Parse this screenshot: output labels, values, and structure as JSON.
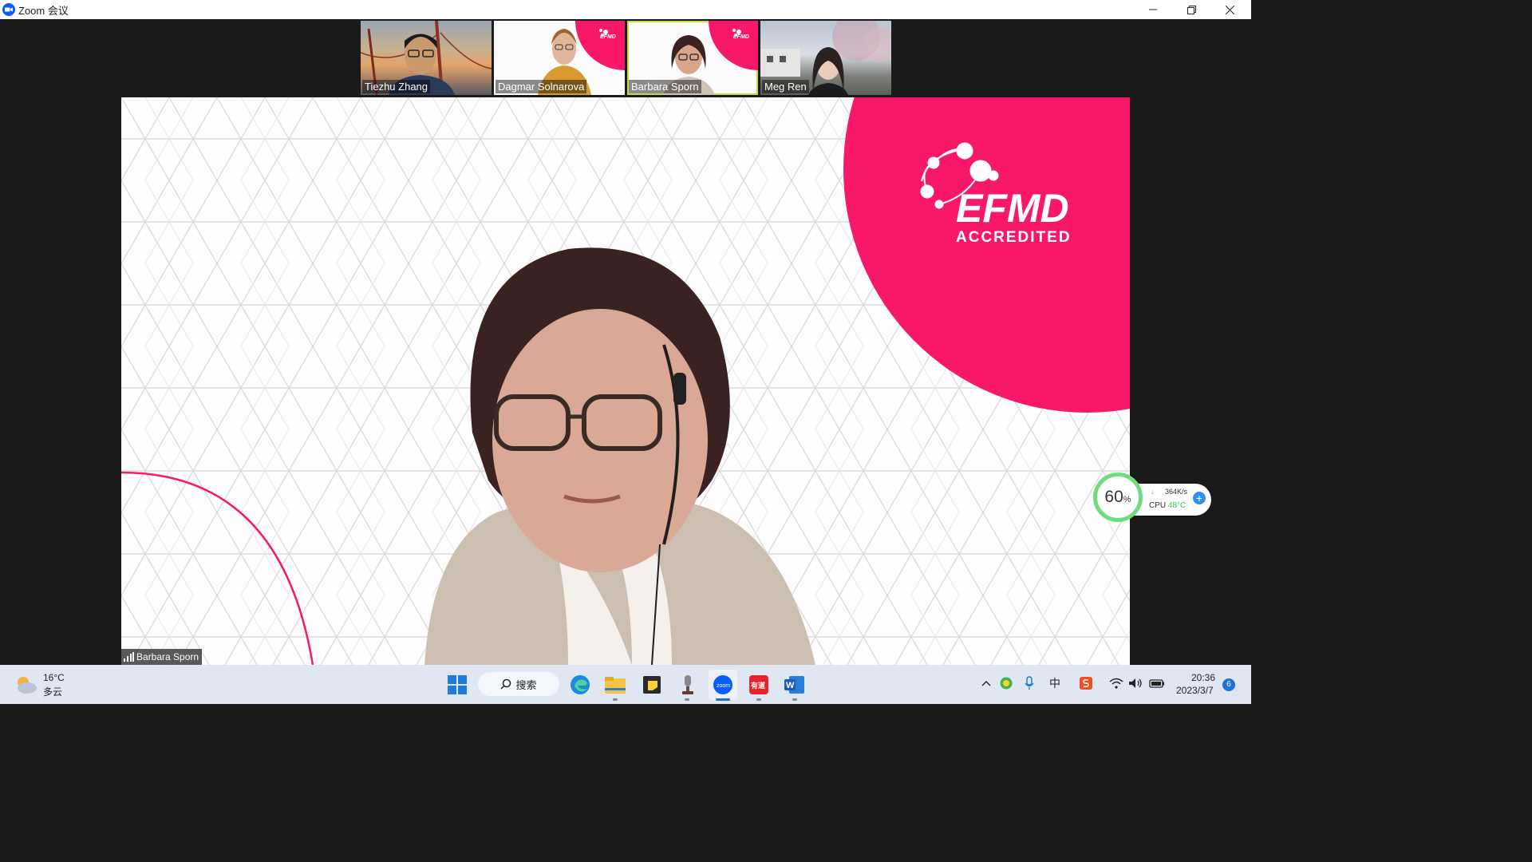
{
  "window": {
    "title": "Zoom 会议",
    "controls": [
      "minimize-icon",
      "restore-icon",
      "close-icon"
    ]
  },
  "participants": [
    {
      "name": "Tiezhu Zhang",
      "background": "golden-gate-bridge"
    },
    {
      "name": "Dagmar Solnarova",
      "background": "efmd-accredited"
    },
    {
      "name": "Barbara Sporn",
      "background": "efmd-accredited",
      "active": true
    },
    {
      "name": "Meg Ren",
      "background": "campus"
    }
  ],
  "main_video": {
    "speaker_name": "Barbara Sporn",
    "logo_text": "EFMD",
    "logo_subtext": "ACCREDITED",
    "accent_color": "#f7186a"
  },
  "system_monitor": {
    "percent": "60",
    "percent_unit": "%",
    "net_speed": "364K/s",
    "cpu_label": "CPU",
    "cpu_temp": "48°C"
  },
  "taskbar": {
    "weather_temp": "16°C",
    "weather_desc": "多云",
    "search_label": "搜索",
    "apps": [
      "windows-start-icon",
      "edge-icon",
      "file-explorer-icon",
      "sticky-notes-icon",
      "microphone-app-icon",
      "zoom-icon",
      "youdao-icon",
      "word-icon"
    ],
    "tray_icons": [
      "chevron-up-icon",
      "360-security-icon",
      "microphone-icon",
      "ime-icon",
      "sogou-icon",
      "wifi-icon",
      "volume-icon",
      "battery-icon"
    ],
    "ime_label": "中",
    "youdao_label": "有道",
    "word_label": "W",
    "time": "20:36",
    "date": "2023/3/7",
    "notification_count": "6"
  }
}
